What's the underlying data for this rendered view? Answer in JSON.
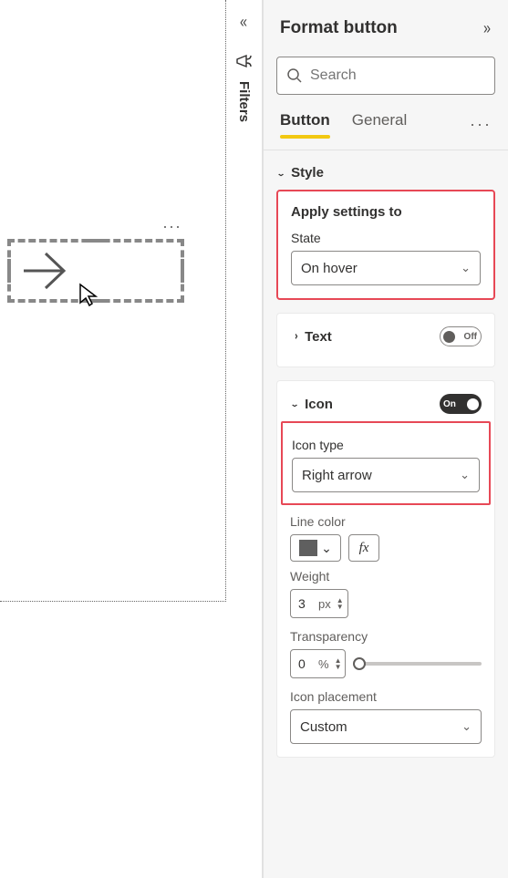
{
  "canvas": {
    "ellipsis": "···"
  },
  "filters": {
    "label": "Filters"
  },
  "panel": {
    "title": "Format button",
    "search_placeholder": "Search",
    "tabs": {
      "button": "Button",
      "general": "General"
    },
    "more": "···",
    "style": {
      "header": "Style",
      "apply_label": "Apply settings to",
      "state_label": "State",
      "state_value": "On hover"
    },
    "text": {
      "header": "Text",
      "toggle_label": "Off"
    },
    "icon": {
      "header": "Icon",
      "toggle_label": "On",
      "type_label": "Icon type",
      "type_value": "Right arrow",
      "linecolor_label": "Line color",
      "linecolor_hex": "#5f5f5f",
      "fx": "fx",
      "weight_label": "Weight",
      "weight_value": "3",
      "weight_unit": "px",
      "transparency_label": "Transparency",
      "transparency_value": "0",
      "transparency_unit": "%",
      "placement_label": "Icon placement",
      "placement_value": "Custom"
    }
  }
}
